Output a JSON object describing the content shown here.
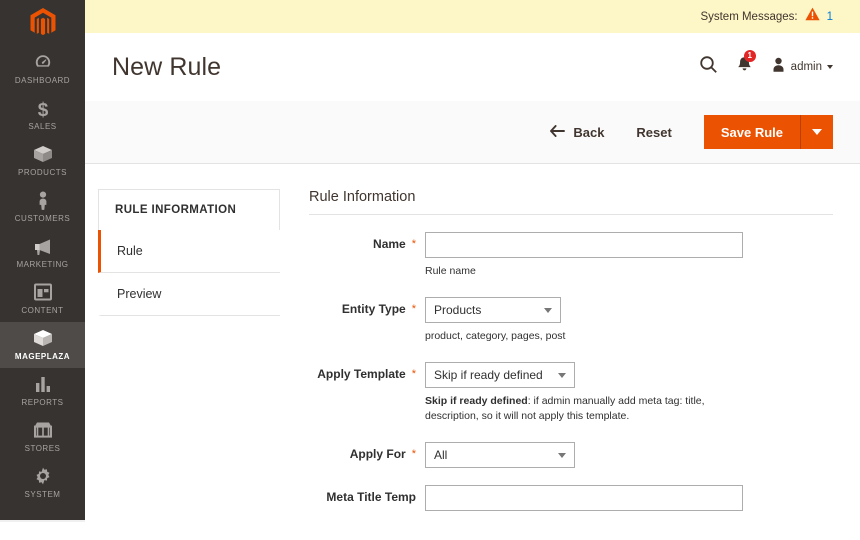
{
  "sidebar": {
    "logo_name": "magento-logo",
    "items": [
      {
        "label": "DASHBOARD",
        "icon": "dashboard-icon",
        "active": false
      },
      {
        "label": "SALES",
        "icon": "dollar-icon",
        "active": false
      },
      {
        "label": "PRODUCTS",
        "icon": "box-icon",
        "active": false
      },
      {
        "label": "CUSTOMERS",
        "icon": "person-icon",
        "active": false
      },
      {
        "label": "MARKETING",
        "icon": "megaphone-icon",
        "active": false
      },
      {
        "label": "CONTENT",
        "icon": "layout-icon",
        "active": false
      },
      {
        "label": "MAGEPLAZA",
        "icon": "box-icon",
        "active": true
      },
      {
        "label": "REPORTS",
        "icon": "bar-chart-icon",
        "active": false
      },
      {
        "label": "STORES",
        "icon": "store-icon",
        "active": false
      },
      {
        "label": "SYSTEM",
        "icon": "gear-icon",
        "active": false
      }
    ]
  },
  "system_messages": {
    "label": "System Messages:",
    "count": "1",
    "warning_icon": "warning-triangle-icon",
    "bar_color": "#fdf6c6",
    "count_color": "#007bdb"
  },
  "header": {
    "title": "New Rule",
    "search_icon": "search-icon",
    "notifications_icon": "bell-icon",
    "notifications_count": "1",
    "user_icon": "user-avatar-icon",
    "user_name": "admin"
  },
  "page_actions": {
    "back_label": "Back",
    "back_icon": "arrow-left-icon",
    "reset_label": "Reset",
    "save_label": "Save Rule",
    "save_more_icon": "chevron-down-icon",
    "accent_color": "#eb5202"
  },
  "tabs": {
    "title": "RULE INFORMATION",
    "items": [
      {
        "label": "Rule",
        "active": true
      },
      {
        "label": "Preview",
        "active": false
      }
    ]
  },
  "form": {
    "legend": "Rule Information",
    "required_marker": "*",
    "fields": [
      {
        "label": "Name",
        "required": true,
        "type": "text",
        "value": "",
        "note": "Rule name"
      },
      {
        "label": "Entity Type",
        "required": true,
        "type": "select",
        "value": "Products",
        "note": "product, category, pages, post"
      },
      {
        "label": "Apply Template",
        "required": true,
        "type": "select",
        "value": "Skip if ready defined",
        "note_bold": "Skip if ready defined",
        "note_rest": ": if admin manually add meta tag: title, description, so it will not apply this template."
      },
      {
        "label": "Apply For",
        "required": true,
        "type": "select",
        "value": "All",
        "note": ""
      },
      {
        "label": "Meta Title Temp",
        "required": false,
        "type": "text",
        "value": "",
        "note": ""
      }
    ]
  }
}
